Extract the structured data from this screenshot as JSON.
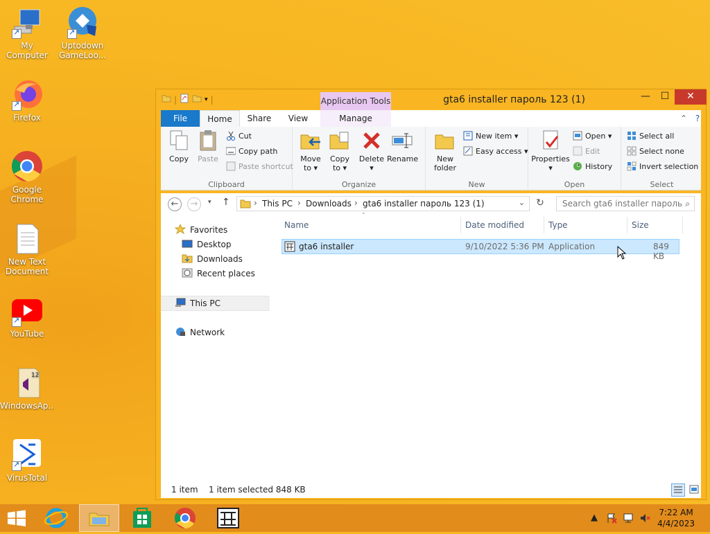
{
  "desktop": {
    "icons": [
      {
        "label": "My Computer"
      },
      {
        "label": "Uptodown GameLoo..."
      },
      {
        "label": "Firefox"
      },
      {
        "label": "Google Chrome"
      },
      {
        "label": "New Text Document"
      },
      {
        "label": "YouTube"
      },
      {
        "label": "WindowsAp..."
      },
      {
        "label": "VirusTotal"
      }
    ]
  },
  "window": {
    "title": "gta6 installer пароль 123 (1)",
    "context_tab_group": "Application Tools",
    "controls": {
      "minimize": "—",
      "maximize": "☐",
      "close": "✕"
    }
  },
  "ribbon": {
    "tabs": {
      "file": "File",
      "home": "Home",
      "share": "Share",
      "view": "View",
      "manage": "Manage"
    },
    "clipboard": {
      "label": "Clipboard",
      "copy": "Copy",
      "paste": "Paste",
      "cut": "Cut",
      "copy_path": "Copy path",
      "paste_shortcut": "Paste shortcut"
    },
    "organize": {
      "label": "Organize",
      "move_to": "Move to ▾",
      "copy_to": "Copy to ▾",
      "delete": "Delete ▾",
      "rename": "Rename",
      "move_to_l1": "Move",
      "move_to_l2": "to ▾",
      "copy_to_l1": "Copy",
      "copy_to_l2": "to ▾"
    },
    "new": {
      "label": "New",
      "new_folder_l1": "New",
      "new_folder_l2": "folder",
      "new_item": "New item ▾",
      "easy_access": "Easy access ▾"
    },
    "open": {
      "label": "Open",
      "properties": "Properties",
      "properties_arrow": "▾",
      "open": "Open ▾",
      "edit": "Edit",
      "history": "History"
    },
    "select": {
      "label": "Select",
      "select_all": "Select all",
      "select_none": "Select none",
      "invert_selection": "Invert selection"
    }
  },
  "address": {
    "crumbs": [
      "This PC",
      "Downloads",
      "gta6 installer пароль 123 (1)"
    ],
    "search_placeholder": "Search gta6 installer пароль 1..."
  },
  "navpane": {
    "favorites": "Favorites",
    "desktop": "Desktop",
    "downloads": "Downloads",
    "recent_places": "Recent places",
    "this_pc": "This PC",
    "network": "Network"
  },
  "filelist": {
    "columns": {
      "name": "Name",
      "date": "Date modified",
      "type": "Type",
      "size": "Size"
    },
    "rows": [
      {
        "name": "gta6 installer",
        "date": "9/10/2022 5:36 PM",
        "type": "Application",
        "size": "849 KB"
      }
    ]
  },
  "status": {
    "count": "1 item",
    "selected": "1 item selected  848 KB"
  },
  "taskbar": {
    "time": "7:22 AM",
    "date": "4/4/2023"
  }
}
